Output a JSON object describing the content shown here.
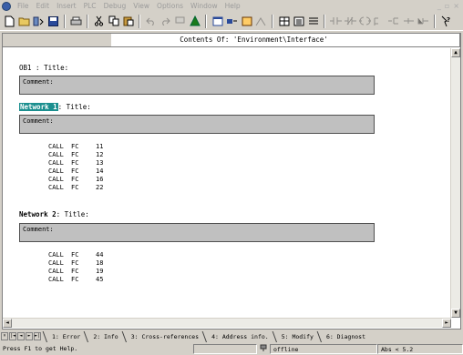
{
  "menu": [
    "File",
    "Edit",
    "Insert",
    "PLC",
    "Debug",
    "View",
    "Options",
    "Window",
    "Help"
  ],
  "window": {
    "title": "Contents Of: 'Environment\\Interface'"
  },
  "editor": {
    "ob_title": "OB1 : Title:",
    "comment_label": "Comment:",
    "networks": [
      {
        "label": "Network 1",
        "title_suffix": ": Title:",
        "comment": "Comment:",
        "statements": [
          [
            "CALL",
            "FC",
            "11"
          ],
          [
            "CALL",
            "FC",
            "12"
          ],
          [
            "CALL",
            "FC",
            "13"
          ],
          [
            "CALL",
            "FC",
            "14"
          ],
          [
            "CALL",
            "FC",
            "16"
          ],
          [
            "CALL",
            "FC",
            "22"
          ]
        ]
      },
      {
        "label": "Network 2",
        "title_suffix": ": Title:",
        "comment": "Comment:",
        "statements": [
          [
            "CALL",
            "FC",
            "44"
          ],
          [
            "CALL",
            "FC",
            "18"
          ],
          [
            "CALL",
            "FC",
            "19"
          ],
          [
            "CALL",
            "FC",
            "45"
          ]
        ]
      }
    ]
  },
  "tabs": [
    "1: Error",
    "2: Info",
    "3: Cross-references",
    "4: Address info.",
    "5: Modify",
    "6: Diagnost"
  ],
  "status": {
    "help": "Press F1 to get Help.",
    "mode": "offline",
    "version": "Abs < 5.2"
  },
  "colors": {
    "highlight": "#1b8f8f",
    "comment_bg": "#c0c0c0"
  }
}
